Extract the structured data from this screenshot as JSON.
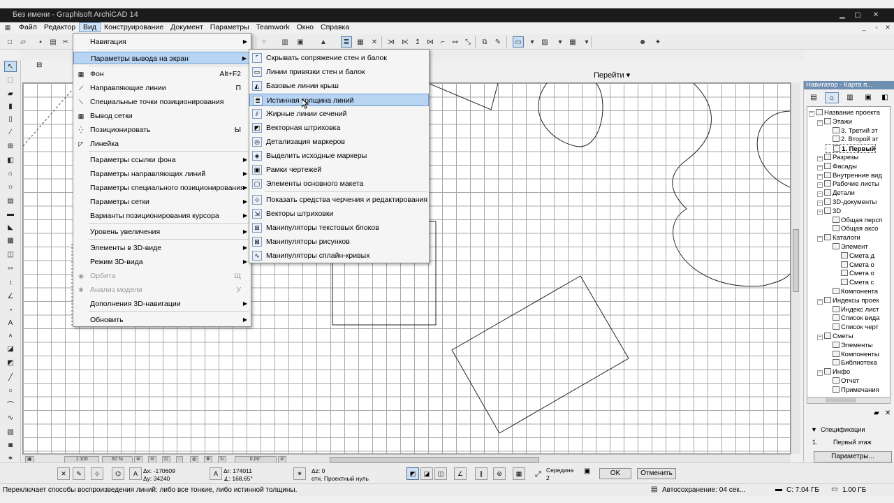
{
  "window": {
    "title": "Без имени - Graphisoft ArchiCAD 14"
  },
  "menubar": {
    "items": [
      "Файл",
      "Редактор",
      "Вид",
      "Конструирование",
      "Документ",
      "Параметры",
      "Teamwork",
      "Окно",
      "Справка"
    ]
  },
  "toolbar": {
    "goto_label": "Перейти"
  },
  "view_menu": {
    "items": [
      {
        "label": "Навигация",
        "shortcut": "",
        "submenu": true
      },
      {
        "label": "Параметры вывода на экран",
        "shortcut": "",
        "submenu": true
      },
      {
        "label": "Фон",
        "shortcut": "Alt+F2"
      },
      {
        "label": "Направляющие линии",
        "shortcut": "П"
      },
      {
        "label": "Специальные точки позиционирования",
        "shortcut": ""
      },
      {
        "label": "Вывод сетки",
        "shortcut": ""
      },
      {
        "label": "Позиционировать",
        "shortcut": "Ы"
      },
      {
        "label": "Линейка",
        "shortcut": ""
      },
      {
        "label": "Параметры ссылки фона",
        "shortcut": "",
        "submenu": true
      },
      {
        "label": "Параметры направляющих линий",
        "shortcut": "",
        "submenu": true
      },
      {
        "label": "Параметры специального позиционирования",
        "shortcut": "",
        "submenu": true
      },
      {
        "label": "Параметры сетки",
        "shortcut": "",
        "submenu": true
      },
      {
        "label": "Варианты позиционирования курсора",
        "shortcut": "",
        "submenu": true
      },
      {
        "label": "Уровень увеличения",
        "shortcut": "",
        "submenu": true
      },
      {
        "label": "Элементы в 3D-виде",
        "shortcut": "",
        "submenu": true
      },
      {
        "label": "Режим 3D-вида",
        "shortcut": "",
        "submenu": true
      },
      {
        "label": "Орбита",
        "shortcut": "Щ"
      },
      {
        "label": "Анализ модели",
        "shortcut": "У"
      },
      {
        "label": "Дополнения 3D-навигации",
        "shortcut": "",
        "submenu": true
      },
      {
        "label": "Обновить",
        "shortcut": "",
        "submenu": true
      }
    ]
  },
  "display_submenu": {
    "items": [
      "Скрывать сопряжение стен и балок",
      "Линии привязки стен и балок",
      "Базовые линии крыш",
      "Истинная толщина линий",
      "Жирные линии сечений",
      "Векторная штриховка",
      "Детализация маркеров",
      "Выделить исходные маркеры",
      "Рамки чертежей",
      "Элементы основного макета",
      "Показать средства черчения и редактирования",
      "Векторы штриховки",
      "Манипуляторы текстовых блоков",
      "Манипуляторы рисунков",
      "Манипуляторы сплайн-кривых"
    ]
  },
  "navigator": {
    "header": "Навигатор - Карта п...",
    "tree": [
      {
        "label": "Название проекта",
        "level": 0
      },
      {
        "label": "Этажи",
        "level": 1
      },
      {
        "label": "3. Третий эт",
        "level": 2
      },
      {
        "label": "2. Второй эт",
        "level": 2
      },
      {
        "label": "1. Первый",
        "level": 2,
        "selected": true
      },
      {
        "label": "Разрезы",
        "level": 1
      },
      {
        "label": "Фасады",
        "level": 1
      },
      {
        "label": "Внутренние вид",
        "level": 1
      },
      {
        "label": "Рабочие листы",
        "level": 1
      },
      {
        "label": "Детали",
        "level": 1
      },
      {
        "label": "3D-документы",
        "level": 1
      },
      {
        "label": "3D",
        "level": 1
      },
      {
        "label": "Общая персп",
        "level": 2
      },
      {
        "label": "Общая аксо",
        "level": 2
      },
      {
        "label": "Каталоги",
        "level": 1
      },
      {
        "label": "Элемент",
        "level": 2
      },
      {
        "label": "Смета д",
        "level": 3
      },
      {
        "label": "Смета о",
        "level": 3
      },
      {
        "label": "Смета о",
        "level": 3
      },
      {
        "label": "Смета с",
        "level": 3
      },
      {
        "label": "Компонента",
        "level": 2
      },
      {
        "label": "Индексы проек",
        "level": 1
      },
      {
        "label": "Индекс лист",
        "level": 2
      },
      {
        "label": "Список вида",
        "level": 2
      },
      {
        "label": "Список черт",
        "level": 2
      },
      {
        "label": "Сметы",
        "level": 1
      },
      {
        "label": "Элементы",
        "level": 2
      },
      {
        "label": "Компоненты",
        "level": 2
      },
      {
        "label": "Библиотека",
        "level": 2
      },
      {
        "label": "Инфо",
        "level": 1
      },
      {
        "label": "Отчет",
        "level": 2
      },
      {
        "label": "Примечания",
        "level": 2
      }
    ],
    "specs_label": "Спецификации",
    "specs_row_num": "1.",
    "specs_row_value": "Первый этаж",
    "params_button": "Параметры..."
  },
  "zoom": {
    "scale": "1:100",
    "percent": "60 %",
    "angle": "0,00°"
  },
  "coords": {
    "dx": "Δx: -170609",
    "dy": "Δy: 34240",
    "dr": "Δr: 174011",
    "da": "∡: 168,65°",
    "dz": "Δz: 0",
    "ref": "отн. Проектный нуль",
    "middle": "Середина",
    "middle_num": "2"
  },
  "buttons": {
    "ok": "OK",
    "cancel": "Отменить"
  },
  "status": {
    "hint": "Переключает способы воспроизведения линий: либо все тонкие, либо истинной толщины.",
    "autosave": "Автосохранение: 04 сек...",
    "disk": "C: 7.04 ГБ",
    "memory": "1.00 ГБ"
  },
  "colors": {
    "menu_highlight": "#b7d4f3",
    "nav_header": "#6f8fb1",
    "titlebar": "#1b1b1b"
  }
}
